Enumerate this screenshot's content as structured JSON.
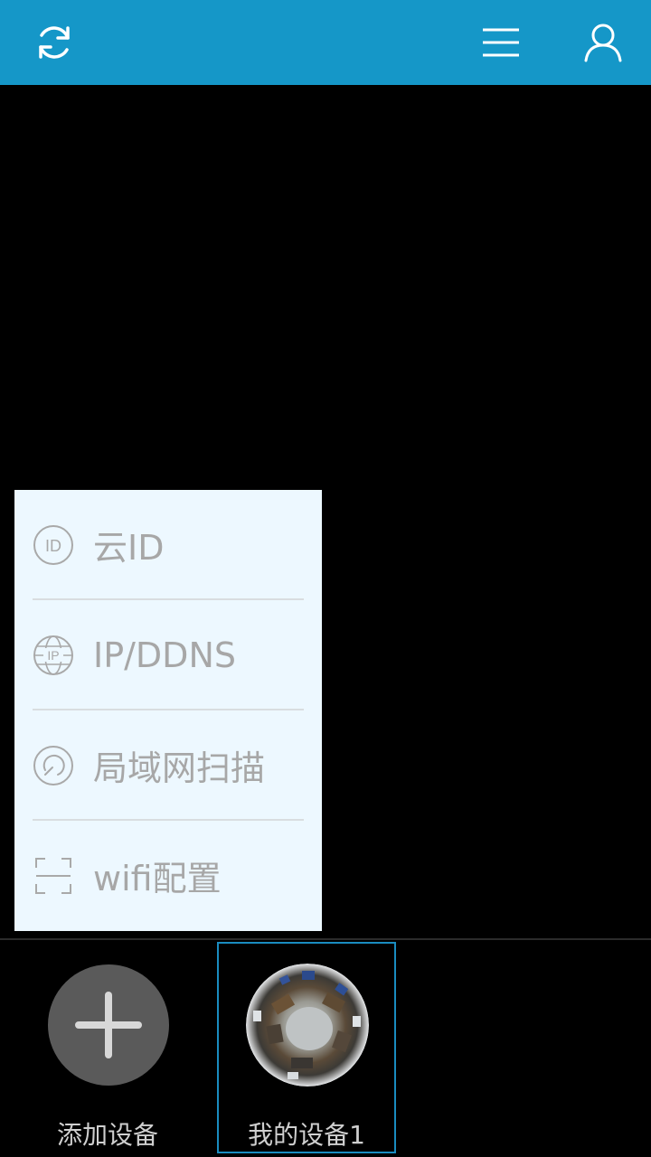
{
  "top_bar": {
    "refresh_icon": "refresh-icon",
    "menu_icon": "hamburger-menu-icon",
    "user_icon": "user-icon",
    "background_color": "#1597c8"
  },
  "add_device_menu": {
    "items": [
      {
        "label": "云ID",
        "icon": "id-badge-icon"
      },
      {
        "label": "IP/DDNS",
        "icon": "ip-globe-icon"
      },
      {
        "label": "局域网扫描",
        "icon": "lan-scan-icon"
      },
      {
        "label": "wifi配置",
        "icon": "scan-frame-icon"
      }
    ]
  },
  "devices": {
    "add_label": "添加设备",
    "items": [
      {
        "label": "我的设备1",
        "selected": true,
        "accent": "#1a8cc0"
      }
    ]
  }
}
